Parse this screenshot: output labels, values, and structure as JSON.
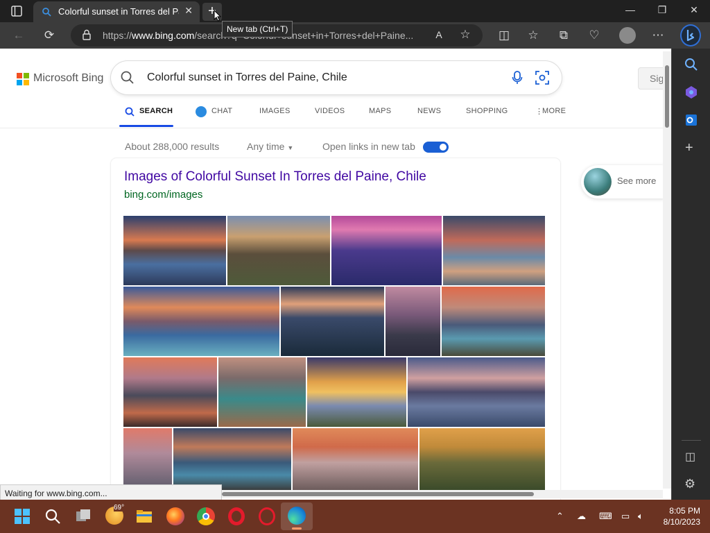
{
  "tab": {
    "title": "Colorful sunset in Torres del Paine, Chile"
  },
  "tooltip": {
    "text": "New tab (Ctrl+T)"
  },
  "address": {
    "prefix": "https://",
    "host": "www.bing.com",
    "path": "/search?q=Colorful+sunset+in+Torres+del+Paine..."
  },
  "bing": {
    "logo": "Microsoft Bing",
    "query": "Colorful sunset in Torres del Paine, Chile",
    "signin": "Sig",
    "scopes": [
      "SEARCH",
      "CHAT",
      "IMAGES",
      "VIDEOS",
      "MAPS",
      "NEWS",
      "SHOPPING",
      "MORE"
    ],
    "results_count": "About 288,000 results",
    "time_filter": "Any time",
    "open_links_label": "Open links in new tab",
    "open_links_on": true,
    "images_title": "Images of Colorful Sunset In Torres del Paine, Chile",
    "images_source": "bing.com/images",
    "see_more": "See more",
    "status": "Waiting for www.bing.com..."
  },
  "taskbar": {
    "weather_temp": "69°",
    "time": "8:05 PM",
    "date": "8/10/2023"
  },
  "colors": {
    "accent": "#174ae4",
    "title_link": "#4007a2",
    "url_green": "#006621",
    "taskbar": "#6b3322"
  }
}
